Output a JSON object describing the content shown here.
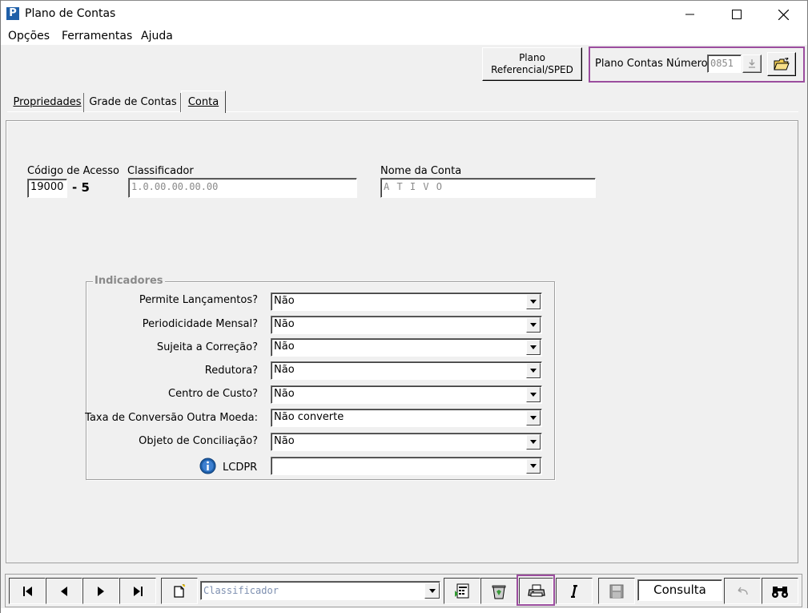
{
  "window": {
    "title": "Plano de Contas",
    "app_icon_letter": "P"
  },
  "menu": {
    "options": "Opções",
    "tools": "Ferramentas",
    "help": "Ajuda"
  },
  "header": {
    "sped_button_line1": "Plano",
    "sped_button_line2": "Referencial/SPED",
    "plan_number_label": "Plano Contas Número",
    "plan_number_value": "0851"
  },
  "tabs": [
    {
      "label": "Propriedades",
      "active": false
    },
    {
      "label": "Grade de Contas",
      "active": false
    },
    {
      "label": "Conta",
      "active": true
    }
  ],
  "account": {
    "access_code_label": "Código de Acesso",
    "access_code_value": "19000",
    "check_digit": "- 5",
    "classifier_label": "Classificador",
    "classifier_value": "1.0.00.00.00.00",
    "account_name_label": "Nome da Conta",
    "account_name_value": "A T I V O"
  },
  "indicators": {
    "title": "Indicadores",
    "rows": [
      {
        "label": "Permite Lançamentos?",
        "value": "Não"
      },
      {
        "label": "Periodicidade Mensal?",
        "value": "Não"
      },
      {
        "label": "Sujeita a Correção?",
        "value": "Não"
      },
      {
        "label": "Redutora?",
        "value": "Não"
      },
      {
        "label": "Centro de Custo?",
        "value": "Não"
      },
      {
        "label": "Taxa de Conversão Outra Moeda:",
        "value": "Não converte"
      },
      {
        "label": "Objeto de Conciliação?",
        "value": "Não"
      },
      {
        "label": "LCDPR",
        "value": ""
      }
    ]
  },
  "toolbar": {
    "search_field_placeholder": "Classificador",
    "mode_label": "Consulta"
  },
  "colors": {
    "highlight": "#9b4d9e",
    "info_icon": "#1f5fa8"
  }
}
